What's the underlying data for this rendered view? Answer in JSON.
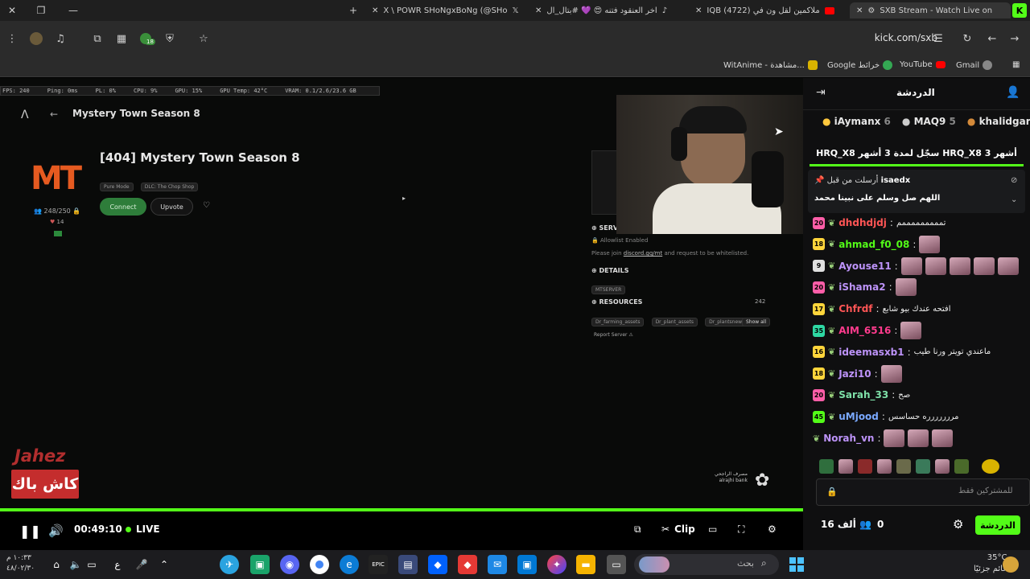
{
  "browser": {
    "tabs": [
      {
        "label": "X \\ POWR SHoNgxBoNg (@SHo"
      },
      {
        "label": "اخر العنقود فتنه 😍 💜 #بتال_ال"
      },
      {
        "label": "IQB (4722) ملاكمين لقل ون في"
      },
      {
        "label": "SXB Stream - Watch Live on"
      }
    ],
    "url": "kick.com/sxb",
    "extension_badge": "18",
    "bookmarks": [
      {
        "label": "WitAnime - مشاهدة..."
      },
      {
        "label": "Google خرائط"
      },
      {
        "label": "YouTube"
      },
      {
        "label": "Gmail"
      }
    ]
  },
  "game": {
    "stats": [
      "FPS: 240",
      "Ping: 0ms",
      "PL: 0%",
      "CPU: 9%",
      "GPU: 15%",
      "GPU Temp: 42°C",
      "VRAM: 0.1/2.6/23.6 GB"
    ],
    "page_title": "Mystery Town Season 8",
    "server_title": "[404] Mystery Town Season 8",
    "chips": [
      "Pure Mode",
      "DLC: The Chop Shop"
    ],
    "players": "248/250",
    "hearts": "14",
    "connect_label": "Connect",
    "upvote_label": "Upvote",
    "server_header": "SERV",
    "allowlist": "Allowlist Enabled",
    "join_text_1": "Please join",
    "join_link": "discord.gg/mt",
    "join_text_2": "and request to be whitelisted.",
    "details_header": "DETAILS",
    "details_chip": "MTSERVER",
    "resources_header": "RESOURCES",
    "resources_count": "242",
    "resources": [
      "Dr_farming_assets",
      "Dr_plant_assets",
      "Dr_plantsnew"
    ],
    "show_all": "Show all",
    "report": "Report Server",
    "sponsor_en": "alrajhi bank",
    "sponsor_ar": "مصرف الراجحي",
    "promo_top": "Jahez",
    "promo_bottom": "كاش باك"
  },
  "player": {
    "time": "00:49:10",
    "live_label": "LIVE",
    "clip_label": "Clip",
    "progress": 1.0
  },
  "chat": {
    "title": "الدردشة",
    "leaders": [
      {
        "name": "iAymanx",
        "count": "6"
      },
      {
        "name": "MAQ9",
        "count": "5"
      },
      {
        "name": "khalidgar",
        "count": ""
      }
    ],
    "sub_banner": "HRQ_X8 سجّل لمدة 3 أشهر HRQ_X8 3 أشهر",
    "pinned_user": "isaedx",
    "pinned_prefix": "أرسلت من قبل",
    "pinned_msg": "اللهم صل وسلم على نبينا محمد",
    "messages": [
      {
        "badge": "20",
        "badge_color": "#ff5ea8",
        "user": "dhdhdjdj",
        "user_color": "#ff5555",
        "text": "تمممممممممم",
        "emotes": 0
      },
      {
        "badge": "18",
        "badge_color": "#ffd53b",
        "user": "ahmad_f0_08",
        "user_color": "#53fc18",
        "text": "",
        "emotes": 1
      },
      {
        "badge": "9",
        "badge_color": "#e0e0e0",
        "user": "Ayouse11",
        "user_color": "#bd93f9",
        "text": "",
        "emotes": 5
      },
      {
        "badge": "20",
        "badge_color": "#ff5ea8",
        "user": "iShama2",
        "user_color": "#bd93f9",
        "text": "",
        "emotes": 1
      },
      {
        "badge": "17",
        "badge_color": "#ffd53b",
        "user": "Chfrdf",
        "user_color": "#ff5555",
        "text": "افتحه عندك بيو شابع",
        "emotes": 0
      },
      {
        "badge": "35",
        "badge_color": "#2ed8a3",
        "user": "AIM_6516",
        "user_color": "#ff3b8d",
        "text": "",
        "emotes": 1
      },
      {
        "badge": "16",
        "badge_color": "#ffd53b",
        "user": "ideemasxb1",
        "user_color": "#bd93f9",
        "text": "ماعندي تويتر ورنا طيب",
        "emotes": 0
      },
      {
        "badge": "18",
        "badge_color": "#ffd53b",
        "user": "Jazi10",
        "user_color": "#bd93f9",
        "text": "",
        "emotes": 1
      },
      {
        "badge": "20",
        "badge_color": "#ff5ea8",
        "user": "Sarah_33",
        "user_color": "#7ee0a8",
        "text": "صح",
        "emotes": 0
      },
      {
        "badge": "45",
        "badge_color": "#53fc18",
        "user": "uMjood",
        "user_color": "#7aa9ff",
        "text": "مررررررره حساسس",
        "emotes": 0
      },
      {
        "badge": "",
        "badge_color": "",
        "user": "Norah_vn",
        "user_color": "#bd93f9",
        "text": "",
        "emotes": 3
      }
    ],
    "input_placeholder": "للمشتركين فقط",
    "viewers": "16 ألف",
    "count": "0",
    "chat_button": "الدردشة"
  },
  "taskbar": {
    "search_placeholder": "بحث",
    "weather_temp": "35°C",
    "weather_desc": "غائم جزئيًا",
    "time": "١٠:٣٣ م",
    "date": "٤٨/٠٢/٣٠"
  },
  "colors": {
    "kick_green": "#53fc18",
    "brand_orange": "#e55a20"
  }
}
